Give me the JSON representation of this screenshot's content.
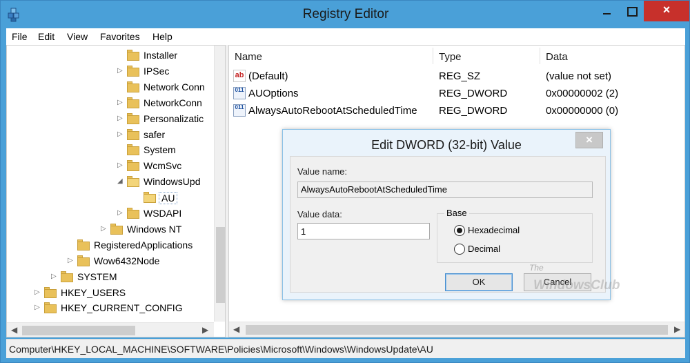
{
  "window": {
    "title": "Registry Editor"
  },
  "titlebar": {
    "close_glyph": "×"
  },
  "menu": [
    "File",
    "Edit",
    "View",
    "Favorites",
    "Help"
  ],
  "tree": {
    "items": [
      {
        "label": "Installer",
        "expander": "",
        "open": false
      },
      {
        "label": "IPSec",
        "expander": "▷",
        "open": false
      },
      {
        "label": "Network Conn",
        "expander": "",
        "open": false
      },
      {
        "label": "NetworkConn",
        "expander": "▷",
        "open": false
      },
      {
        "label": "Personalizatic",
        "expander": "▷",
        "open": false
      },
      {
        "label": "safer",
        "expander": "▷",
        "open": false
      },
      {
        "label": "System",
        "expander": "",
        "open": false
      },
      {
        "label": "WcmSvc",
        "expander": "▷",
        "open": false
      },
      {
        "label": "WindowsUpd",
        "expander": "◢",
        "open": true
      },
      {
        "label": "AU",
        "expander": "",
        "open": true
      },
      {
        "label": "WSDAPI",
        "expander": "▷",
        "open": false
      },
      {
        "label": "Windows NT",
        "expander": "▷",
        "open": false
      },
      {
        "label": "RegisteredApplications",
        "expander": "",
        "open": false
      },
      {
        "label": "Wow6432Node",
        "expander": "▷",
        "open": false
      },
      {
        "label": "SYSTEM",
        "expander": "▷",
        "open": false
      },
      {
        "label": "HKEY_USERS",
        "expander": "▷",
        "open": false
      },
      {
        "label": "HKEY_CURRENT_CONFIG",
        "expander": "▷",
        "open": false
      }
    ],
    "selected": "AU"
  },
  "list": {
    "columns": [
      "Name",
      "Type",
      "Data"
    ],
    "rows": [
      {
        "icon": "ab",
        "name": "(Default)",
        "type": "REG_SZ",
        "data": "(value not set)"
      },
      {
        "icon": "011",
        "name": "AUOptions",
        "type": "REG_DWORD",
        "data": "0x00000002 (2)"
      },
      {
        "icon": "011",
        "name": "AlwaysAutoRebootAtScheduledTime",
        "type": "REG_DWORD",
        "data": "0x00000000 (0)"
      }
    ]
  },
  "status": {
    "path": "Computer\\HKEY_LOCAL_MACHINE\\SOFTWARE\\Policies\\Microsoft\\Windows\\WindowsUpdate\\AU"
  },
  "dialog": {
    "title": "Edit DWORD (32-bit) Value",
    "close_glyph": "×",
    "value_name_label": "Value name:",
    "value_name": "AlwaysAutoRebootAtScheduledTime",
    "value_data_label": "Value data:",
    "value_data": "1",
    "base_label": "Base",
    "base_options": [
      "Hexadecimal",
      "Decimal"
    ],
    "base_selected": "Hexadecimal",
    "ok_label": "OK",
    "cancel_label": "Cancel"
  },
  "watermark": {
    "line1": "The",
    "line2": "WindowsClub"
  }
}
